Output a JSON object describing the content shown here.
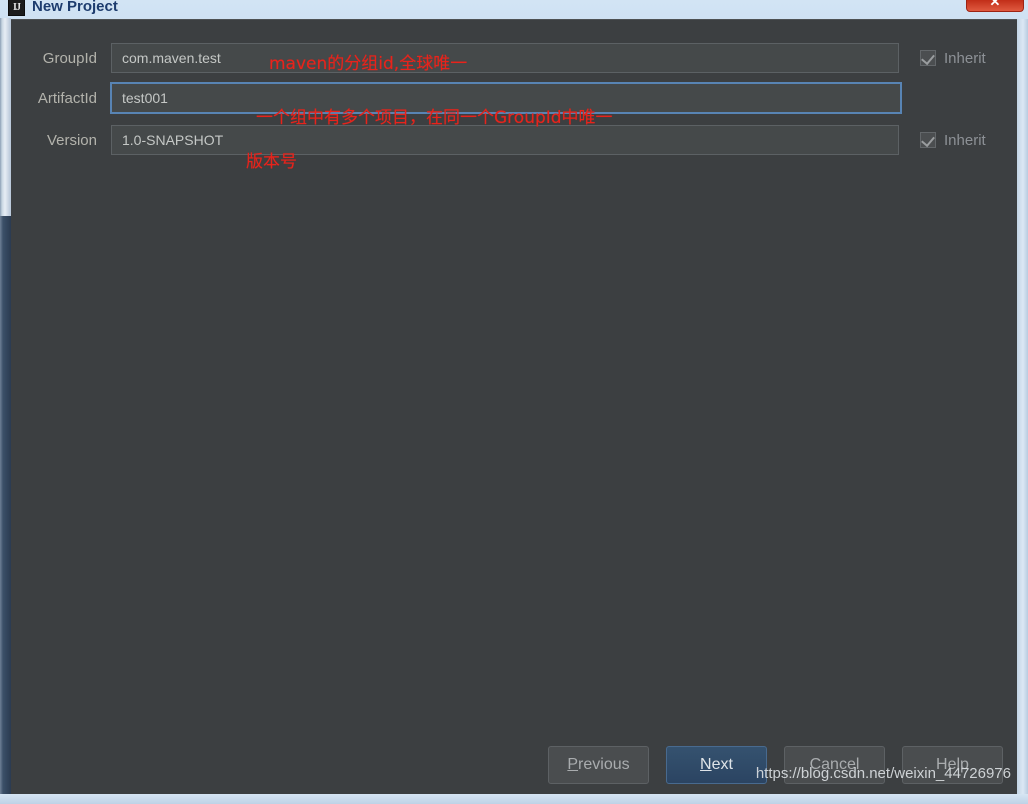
{
  "window": {
    "title": "New Project",
    "app_icon": "intellij-idea-icon",
    "close_label": "✕"
  },
  "form": {
    "fields": [
      {
        "label": "GroupId",
        "value": "com.maven.test",
        "focused": false,
        "inherit_label": "Inherit",
        "inherit_checked": true
      },
      {
        "label": "ArtifactId",
        "value": "test001",
        "focused": true,
        "inherit_label": "",
        "inherit_checked": false
      },
      {
        "label": "Version",
        "value": "1.0-SNAPSHOT",
        "focused": false,
        "inherit_label": "Inherit",
        "inherit_checked": true
      }
    ]
  },
  "annotations": [
    {
      "text": "maven的分组id,全球唯一"
    },
    {
      "text": "一个组中有多个项目，在同一个GroupId中唯一"
    },
    {
      "text": "版本号"
    }
  ],
  "buttons": {
    "previous": {
      "pre": "P",
      "post": "revious"
    },
    "next": {
      "pre": "N",
      "post": "ext"
    },
    "cancel": {
      "text": "Cancel"
    },
    "help": {
      "text": "Help"
    }
  },
  "watermark": {
    "text": "https://blog.csdn.net/weixin_44726976"
  },
  "colors": {
    "dialog_bg": "#3c3f41",
    "input_bg": "#45494a",
    "focus_border": "#5884b4",
    "annotation": "#e8231b",
    "primary_button": "#2b4462",
    "titlebar": "#cfe2f3",
    "close_button": "#d9412a"
  }
}
